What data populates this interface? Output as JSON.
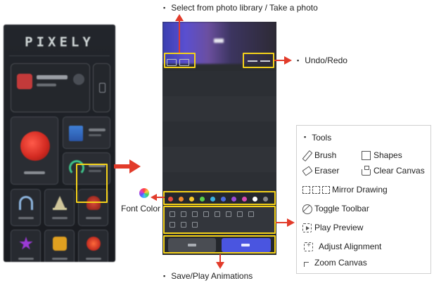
{
  "home": {
    "logo": "PIXELY"
  },
  "editor": {
    "palette_colors": [
      "#e84a3a",
      "#f08a2a",
      "#f5c82a",
      "#5ad04a",
      "#3ab0e0",
      "#4a6ae0",
      "#9a4ad8",
      "#d84ab0",
      "#ffffff",
      "#888888"
    ]
  },
  "callouts": {
    "photo": "Select from photo library / Take a photo",
    "undo_redo": "Undo/Redo",
    "font_color": "Font Color",
    "save_play": "Save/Play Animations"
  },
  "tools": {
    "title": "Tools",
    "brush": "Brush",
    "shapes": "Shapes",
    "eraser": "Eraser",
    "clear_canvas": "Clear Canvas",
    "mirror_drawing": "Mirror Drawing",
    "toggle_toolbar": "Toggle Toolbar",
    "play_preview": "Play Preview",
    "adjust_alignment": "Adjust Alignment",
    "zoom_canvas": "Zoom Canvas"
  },
  "colors": {
    "highlight": "#f5d21a",
    "arrow": "#e23b2a"
  }
}
